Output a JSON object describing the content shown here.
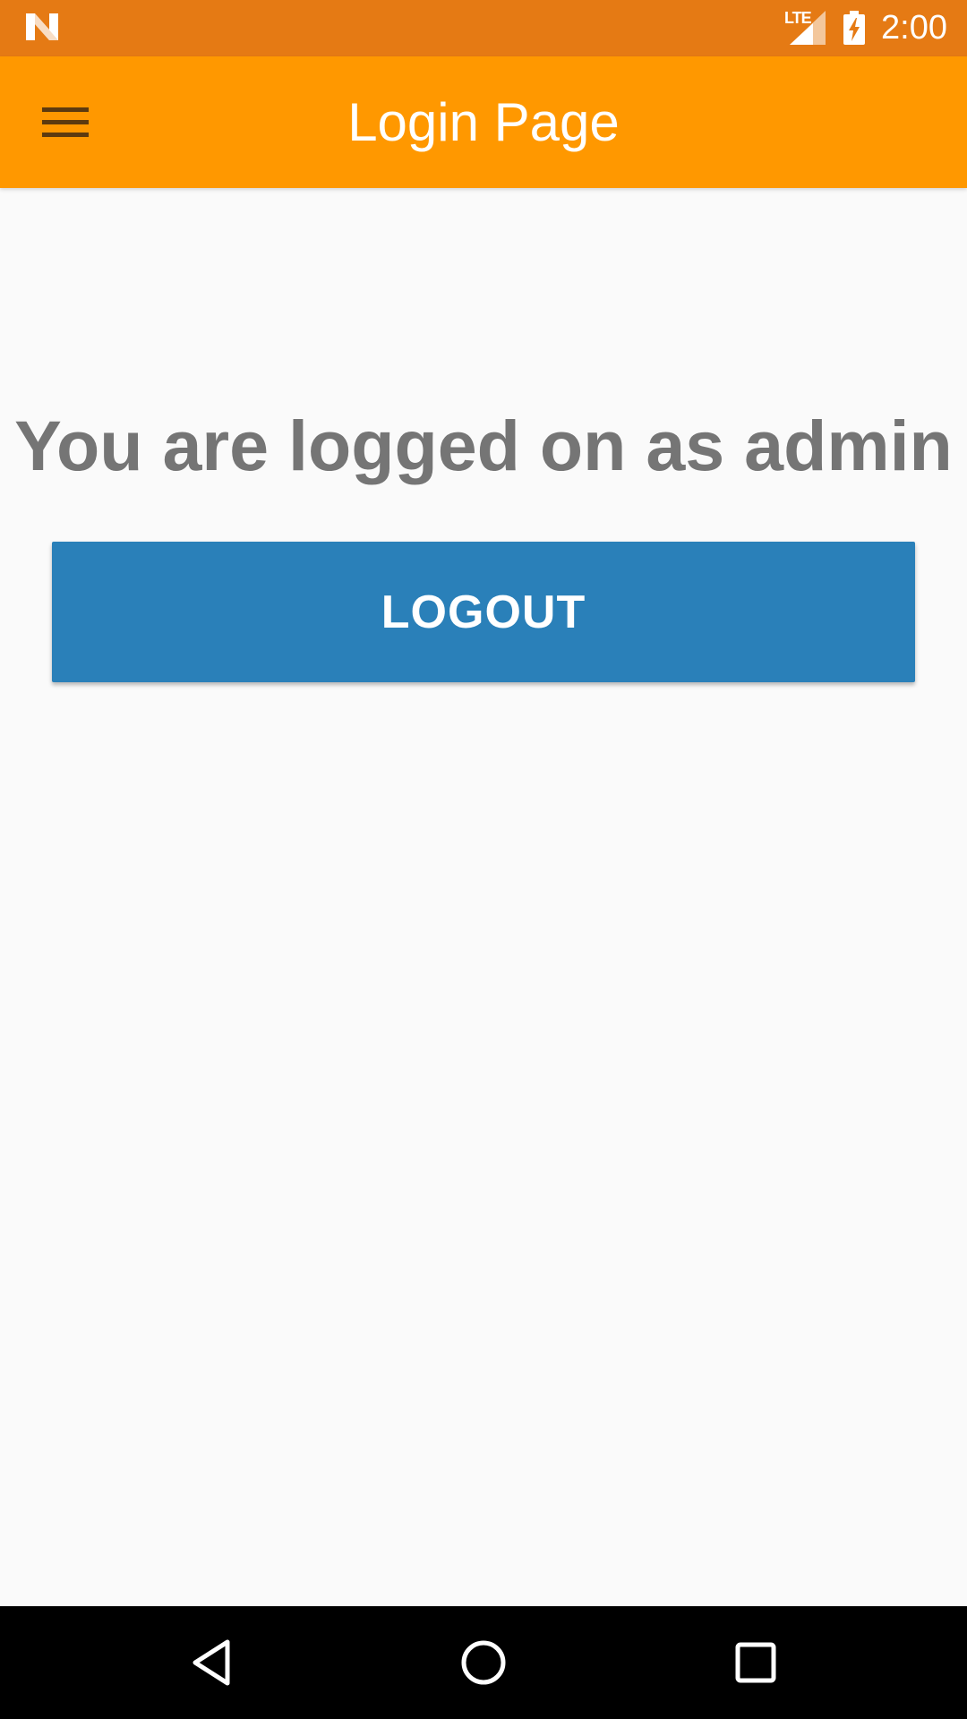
{
  "status_bar": {
    "network_label": "LTE",
    "time": "2:00",
    "icons": [
      "android-n-icon",
      "lte-signal-icon",
      "battery-charging-icon"
    ]
  },
  "app_bar": {
    "title": "Login Page",
    "menu_icon": "hamburger-menu-icon",
    "background_color": "#ff9800"
  },
  "main": {
    "status_message": "You are logged on as admin",
    "logout_label": "LOGOUT",
    "button_color": "#2a80b9"
  },
  "nav_bar": {
    "icons": [
      "back-icon",
      "home-icon",
      "recents-icon"
    ]
  }
}
